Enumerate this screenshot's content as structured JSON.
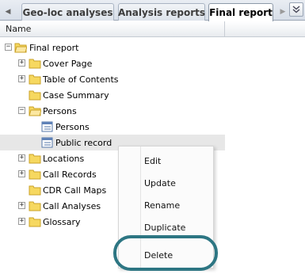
{
  "tabs": [
    {
      "label": "Geo-loc analyses",
      "active": false
    },
    {
      "label": "Analysis reports",
      "active": false
    },
    {
      "label": "Final report",
      "active": true
    }
  ],
  "column_header": "Name",
  "tree": {
    "root": {
      "label": "Final report"
    },
    "items": [
      {
        "label": "Cover Page"
      },
      {
        "label": "Table of Contents"
      },
      {
        "label": "Case Summary"
      },
      {
        "label": "Persons"
      },
      {
        "label": "Persons"
      },
      {
        "label": "Public record"
      },
      {
        "label": "Locations"
      },
      {
        "label": "Call Records"
      },
      {
        "label": "CDR Call Maps"
      },
      {
        "label": "Call Analyses"
      },
      {
        "label": "Glossary"
      }
    ]
  },
  "context_menu": {
    "items": [
      {
        "label": "Edit"
      },
      {
        "label": "Update"
      },
      {
        "label": "Rename"
      },
      {
        "label": "Duplicate"
      },
      {
        "label": "Delete"
      }
    ]
  },
  "colors": {
    "highlight_ring": "#2d7683",
    "folder": "#f6d860",
    "selection": "#e7e7e7"
  }
}
